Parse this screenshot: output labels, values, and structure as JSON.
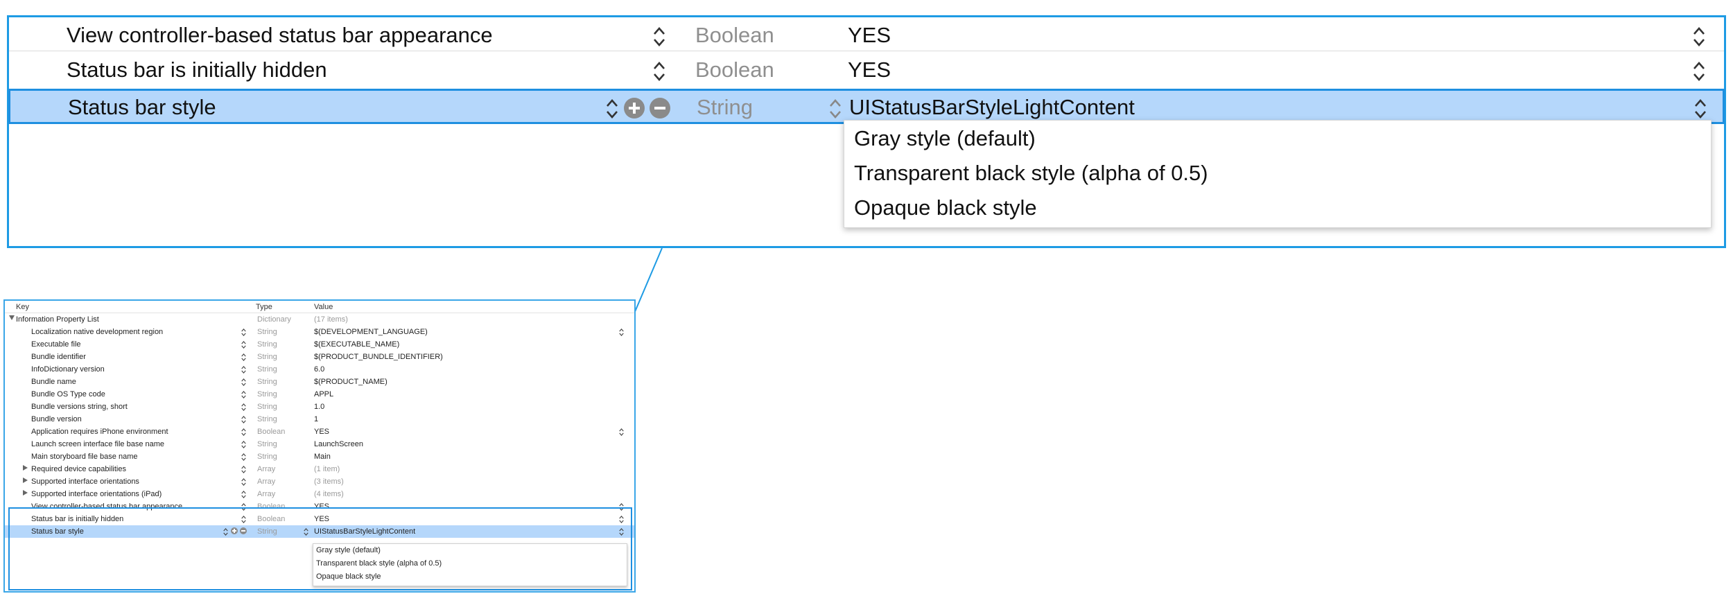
{
  "zoom": {
    "rows": [
      {
        "key": "View controller-based status bar appearance",
        "type": "Boolean",
        "value": "YES"
      },
      {
        "key": "Status bar is initially hidden",
        "type": "Boolean",
        "value": "YES"
      },
      {
        "key": "Status bar style",
        "type": "String",
        "value": "UIStatusBarStyleLightContent"
      }
    ],
    "menu": [
      "Gray style (default)",
      "Transparent black style (alpha of 0.5)",
      "Opaque black style"
    ]
  },
  "plist": {
    "headers": {
      "key": "Key",
      "type": "Type",
      "value": "Value"
    },
    "root": {
      "key": "Information Property List",
      "type": "Dictionary",
      "value": "(17 items)"
    },
    "rows": [
      {
        "key": "Localization native development region",
        "type": "String",
        "value": "$(DEVELOPMENT_LANGUAGE)"
      },
      {
        "key": "Executable file",
        "type": "String",
        "value": "$(EXECUTABLE_NAME)"
      },
      {
        "key": "Bundle identifier",
        "type": "String",
        "value": "$(PRODUCT_BUNDLE_IDENTIFIER)"
      },
      {
        "key": "InfoDictionary version",
        "type": "String",
        "value": "6.0"
      },
      {
        "key": "Bundle name",
        "type": "String",
        "value": "$(PRODUCT_NAME)"
      },
      {
        "key": "Bundle OS Type code",
        "type": "String",
        "value": "APPL"
      },
      {
        "key": "Bundle versions string, short",
        "type": "String",
        "value": "1.0"
      },
      {
        "key": "Bundle version",
        "type": "String",
        "value": "1"
      },
      {
        "key": "Application requires iPhone environment",
        "type": "Boolean",
        "value": "YES"
      },
      {
        "key": "Launch screen interface file base name",
        "type": "String",
        "value": "LaunchScreen"
      },
      {
        "key": "Main storyboard file base name",
        "type": "String",
        "value": "Main"
      },
      {
        "key": "Required device capabilities",
        "type": "Array",
        "value": "(1 item)"
      },
      {
        "key": "Supported interface orientations",
        "type": "Array",
        "value": "(3 items)"
      },
      {
        "key": "Supported interface orientations (iPad)",
        "type": "Array",
        "value": "(4 items)"
      },
      {
        "key": "View controller-based status bar appearance",
        "type": "Boolean",
        "value": "YES"
      },
      {
        "key": "Status bar is initially hidden",
        "type": "Boolean",
        "value": "YES"
      },
      {
        "key": "Status bar style",
        "type": "String",
        "value": "UIStatusBarStyleLightContent"
      }
    ],
    "menu": [
      "Gray style (default)",
      "Transparent black style (alpha of 0.5)",
      "Opaque black style"
    ]
  },
  "colors": {
    "accent": "#1e9be4",
    "selection": "#b5d7fb",
    "muted_text": "#9a9a9a"
  }
}
